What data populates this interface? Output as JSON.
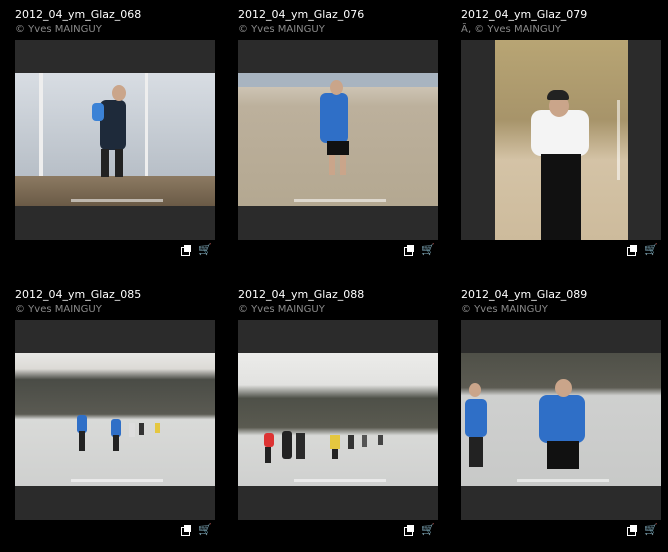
{
  "thumbnails": [
    {
      "title": "2012_04_ym_Glaz_068",
      "credit": "© Yves MAINGUY"
    },
    {
      "title": "2012_04_ym_Glaz_076",
      "credit": "© Yves MAINGUY"
    },
    {
      "title": "2012_04_ym_Glaz_079",
      "credit": "Ã‚ © Yves MAINGUY"
    },
    {
      "title": "2012_04_ym_Glaz_085",
      "credit": "© Yves MAINGUY"
    },
    {
      "title": "2012_04_ym_Glaz_088",
      "credit": "© Yves MAINGUY"
    },
    {
      "title": "2012_04_ym_Glaz_089",
      "credit": "© Yves MAINGUY"
    }
  ],
  "actions": {
    "copy_icon": "copy-icon",
    "cart_icon": "cart-icon"
  }
}
